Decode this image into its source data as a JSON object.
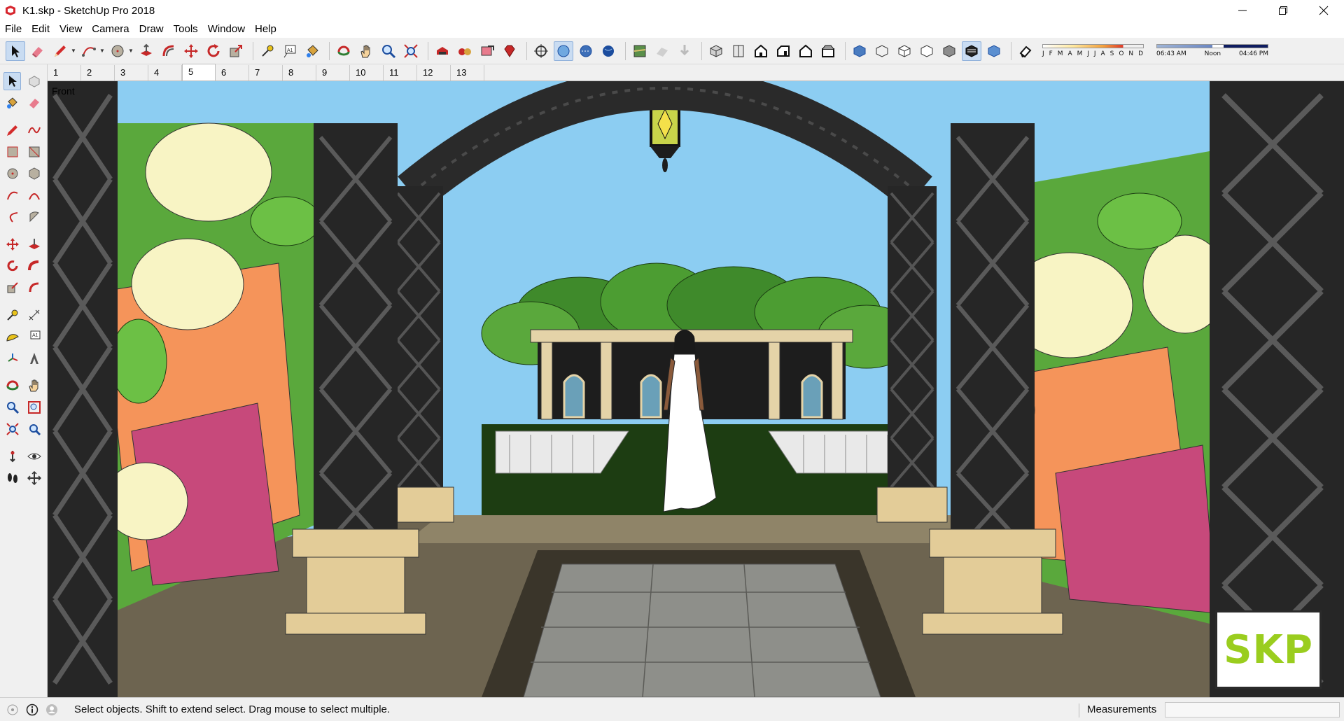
{
  "window": {
    "title": "K1.skp - SketchUp Pro 2018",
    "app_icon": "sketchup-logo-icon",
    "controls": [
      "minimize-icon",
      "restore-icon",
      "close-icon"
    ]
  },
  "menu": [
    "File",
    "Edit",
    "View",
    "Camera",
    "Draw",
    "Tools",
    "Window",
    "Help"
  ],
  "toolbar": {
    "shadow_months": [
      "J",
      "F",
      "M",
      "A",
      "M",
      "J",
      "J",
      "A",
      "S",
      "O",
      "N",
      "D"
    ],
    "shadow_time_start": "06:43 AM",
    "shadow_time_noon": "Noon",
    "shadow_time_end": "04:46 PM"
  },
  "scene_tabs": [
    "1",
    "2",
    "3",
    "4",
    "5",
    "6",
    "7",
    "8",
    "9",
    "10",
    "11",
    "12",
    "13"
  ],
  "active_scene_tab": "5",
  "viewport": {
    "view_label": "Front",
    "badge_text": "SKP",
    "badge_color": "#9acd1e"
  },
  "status": {
    "message": "Select objects. Shift to extend select. Drag mouse to select multiple.",
    "measurements_label": "Measurements",
    "measurements_value": ""
  }
}
